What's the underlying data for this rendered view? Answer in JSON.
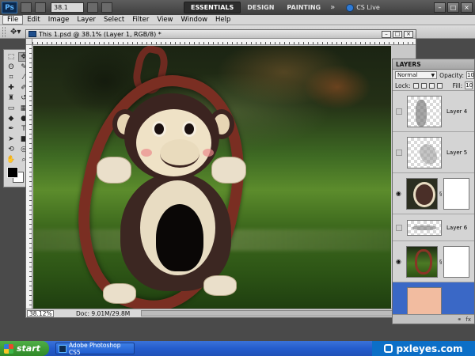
{
  "app": {
    "logo": "Ps",
    "zoom": "38.1",
    "workspaces": [
      "ESSENTIALS",
      "DESIGN",
      "PAINTING"
    ],
    "more": "»",
    "cs_live": "CS Live",
    "window_controls": [
      "–",
      "□",
      "×"
    ]
  },
  "menu": [
    "File",
    "Edit",
    "Image",
    "Layer",
    "Select",
    "Filter",
    "View",
    "Window",
    "Help"
  ],
  "document": {
    "title": "This 1.psd @ 38.1% (Layer 1, RGB/8) *",
    "controls": [
      "–",
      "□",
      "×"
    ],
    "status_zoom": "38.12%",
    "doc_size": "Doc: 9.01M/29.8M"
  },
  "layers_panel": {
    "tab": "LAYERS",
    "blend_mode": "Normal",
    "opacity_label": "Opacity:",
    "opacity_value": "10",
    "lock_label": "Lock:",
    "fill_label": "Fill:",
    "fill_value": "10",
    "layers": [
      {
        "name": "Layer 4",
        "visible": false
      },
      {
        "name": "Layer 5",
        "visible": false
      },
      {
        "name": "",
        "visible": true
      },
      {
        "name": "Layer 6",
        "visible": false
      },
      {
        "name": "",
        "visible": true
      },
      {
        "name": "",
        "visible": false
      }
    ]
  },
  "taskbar": {
    "start": "start",
    "task": "Adobe Photoshop CS5",
    "brand": "pxleyes.com"
  },
  "colors": {
    "selection_blue": "#3a68c6",
    "taskbar_blue": "#245ccc",
    "start_green": "#3c9a34",
    "swing_red": "#7a2e22"
  }
}
